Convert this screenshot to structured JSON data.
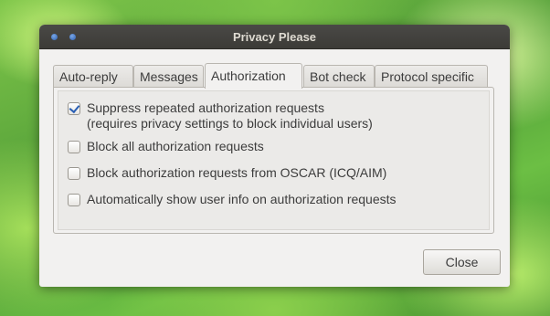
{
  "window": {
    "title": "Privacy Please"
  },
  "tabs": [
    {
      "label": "Auto-reply",
      "active": false
    },
    {
      "label": "Messages",
      "active": false
    },
    {
      "label": "Authorization",
      "active": true
    },
    {
      "label": "Bot check",
      "active": false
    },
    {
      "label": "Protocol specific",
      "active": false
    }
  ],
  "options": [
    {
      "line1": "Suppress repeated authorization requests",
      "line2": "(requires privacy settings to block individual users)",
      "checked": true
    },
    {
      "line1": "Block all authorization requests",
      "checked": false
    },
    {
      "line1": "Block authorization requests from OSCAR (ICQ/AIM)",
      "checked": false
    },
    {
      "line1": "Automatically show user info on authorization requests",
      "checked": false
    }
  ],
  "buttons": {
    "close_label": "Close"
  },
  "colors": {
    "titlebar": "#3c3b37",
    "window_bg": "#f2f1f0",
    "check_accent": "#2a5fb4"
  }
}
